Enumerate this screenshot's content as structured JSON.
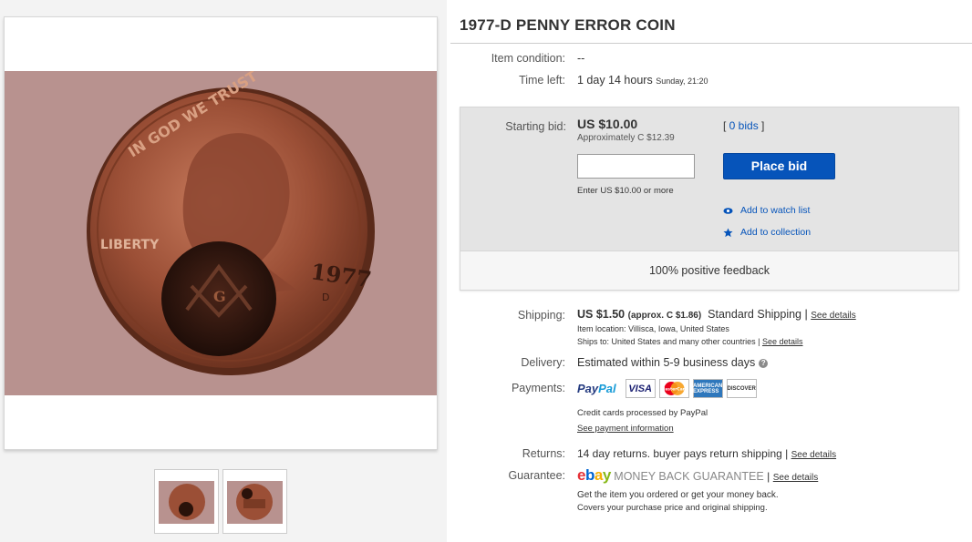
{
  "item": {
    "title": "1977-D PENNY ERROR COIN",
    "condition_label": "Item condition:",
    "condition_value": "--",
    "time_left_label": "Time left:",
    "time_left_value": "1 day 14 hours",
    "time_left_end": "Sunday, 21:20"
  },
  "bid": {
    "starting_label": "Starting bid:",
    "price": "US $10.00",
    "approx": "Approximately C $12.39",
    "bids_open": "[ ",
    "bids_link": "0 bids",
    "bids_close": " ]",
    "input_value": "",
    "hint": "Enter US $10.00 or more",
    "place_bid": "Place bid",
    "watch": "Add to watch list",
    "collection": "Add to collection",
    "feedback": "100% positive feedback"
  },
  "shipping": {
    "label": "Shipping:",
    "cost": "US $1.50",
    "approx": "(approx. C $1.86)",
    "method": "Standard Shipping |",
    "see_details": "See details",
    "location": "Item location:  Villisca, Iowa, United States",
    "ships_to": "Ships to:  United States and many other countries |",
    "ships_see_details": "See details"
  },
  "delivery": {
    "label": "Delivery:",
    "value": "Estimated within 5-9 business days",
    "help": "?"
  },
  "payments": {
    "label": "Payments:",
    "paypal_a": "Pay",
    "paypal_b": "Pal",
    "visa": "VISA",
    "mastercard": "MasterCard",
    "amex": "AMERICAN EXPRESS",
    "discover": "DISCOVER",
    "credit_note": "Credit cards processed by PayPal",
    "see_payment": "See payment information"
  },
  "returns": {
    "label": "Returns:",
    "value": "14 day returns. buyer pays return shipping |",
    "see_details": "See details"
  },
  "guarantee": {
    "label": "Guarantee:",
    "ebay_e": "e",
    "ebay_b": "b",
    "ebay_a": "a",
    "ebay_y": "y",
    "mbg": "MONEY BACK GUARANTEE",
    "sep": "|",
    "see_details": "See details",
    "line1": "Get the item you ordered or get your money back.",
    "line2": "Covers your purchase price and original shipping."
  },
  "coin": {
    "motto": "IN GOD WE TRUST",
    "liberty": "LIBERTY",
    "year": "1977",
    "mint": "D",
    "emblem": "G"
  },
  "colors": {
    "accent_blue": "#0654ba",
    "ebay_red": "#e53238",
    "ebay_blue": "#0064d2",
    "ebay_yellow": "#f5af02",
    "ebay_green": "#86b817"
  }
}
